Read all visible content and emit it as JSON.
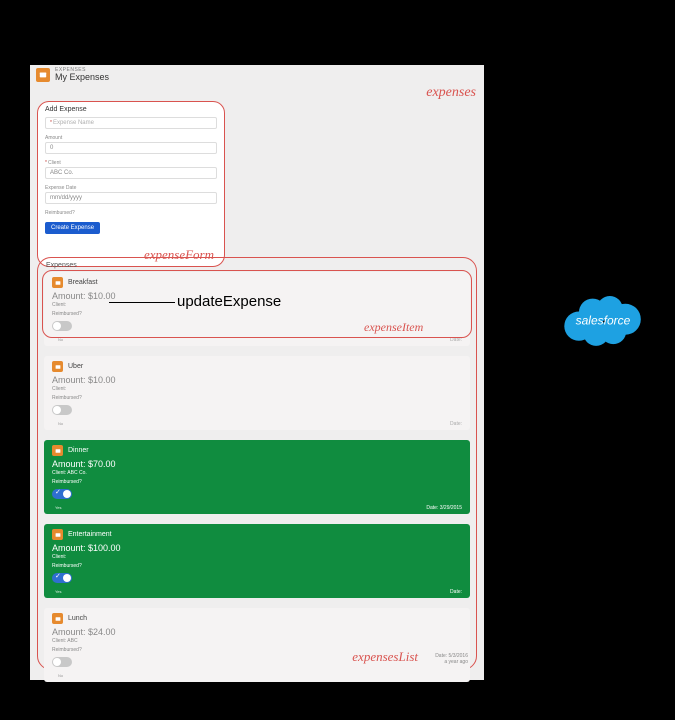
{
  "header": {
    "super": "EXPENSES",
    "title": "My Expenses"
  },
  "annotations": {
    "expenses": "expenses",
    "expenseForm": "expenseForm",
    "expenseItem": "expenseItem",
    "expensesList": "expensesList",
    "updateExpense": "updateExpense"
  },
  "form": {
    "title": "Add Expense",
    "namePlaceholder": "Expense Name",
    "amountLabel": "Amount",
    "amountValue": "0",
    "clientLabel": "Client",
    "clientValue": "ABC Co.",
    "dateLabel": "Expense Date",
    "datePlaceholder": "mm/dd/yyyy",
    "reimbursedLabel": "Reimbursed?",
    "createButton": "Create Expense"
  },
  "list": {
    "title": "Expenses",
    "footerDate": "Date: 5/3/2016",
    "footerAgo": "a year ago"
  },
  "items": [
    {
      "name": "Breakfast",
      "amountLabel": "Amount: $10.00",
      "clientLabel": "Client:",
      "reimbursedLabel": "Reimbursed?",
      "toggle": "off",
      "toggleSub": "No",
      "dateLabel": "Date:",
      "reimbursed": false
    },
    {
      "name": "Uber",
      "amountLabel": "Amount: $10.00",
      "clientLabel": "Client:",
      "reimbursedLabel": "Reimbursed?",
      "toggle": "off",
      "toggleSub": "No",
      "dateLabel": "Date:",
      "reimbursed": false
    },
    {
      "name": "Dinner",
      "amountLabel": "Amount: $70.00",
      "clientLabel": "Client: ABC Co.",
      "reimbursedLabel": "Reimbursed?",
      "toggle": "on",
      "toggleSub": "Yes",
      "dateLabel": "Date: 3/29/2015",
      "reimbursed": true
    },
    {
      "name": "Entertainment",
      "amountLabel": "Amount: $100.00",
      "clientLabel": "Client:",
      "reimbursedLabel": "Reimbursed?",
      "toggle": "on",
      "toggleSub": "Yes",
      "dateLabel": "Date:",
      "reimbursed": true
    },
    {
      "name": "Lunch",
      "amountLabel": "Amount: $24.00",
      "clientLabel": "Client: ABC",
      "reimbursedLabel": "Reimbursed?",
      "toggle": "off",
      "toggleSub": "No",
      "dateLabel": "",
      "reimbursed": false
    }
  ],
  "salesforce": {
    "label": "salesforce"
  }
}
